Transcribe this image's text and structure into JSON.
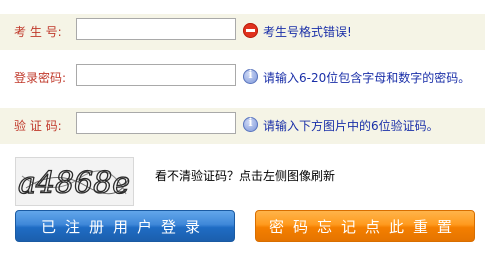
{
  "form": {
    "candidate_number": {
      "label": "考 生 号:",
      "value": "",
      "message": "考生号格式错误!",
      "status": "error"
    },
    "password": {
      "label": "登录密码:",
      "value": "",
      "message": "请输入6-20位包含字母和数字的密码。",
      "status": "info"
    },
    "captcha": {
      "label": "验 证 码:",
      "value": "",
      "message": "请输入下方图片中的6位验证码。",
      "status": "info"
    },
    "captcha_image": {
      "text": "a4868e",
      "hint": "看不清验证码？点击左侧图像刷新"
    }
  },
  "buttons": {
    "login": "已注册用户登录",
    "reset_password": "密码忘记点此重置"
  },
  "colors": {
    "label": "#c0392b",
    "message": "#1a2fa8",
    "row_shade": "#f5f4e6",
    "login_button": "#3f88d9",
    "reset_button": "#ff9a1e"
  },
  "icons": {
    "candidate_status": "error-icon",
    "password_status": "info-icon",
    "captcha_status": "info-icon"
  }
}
